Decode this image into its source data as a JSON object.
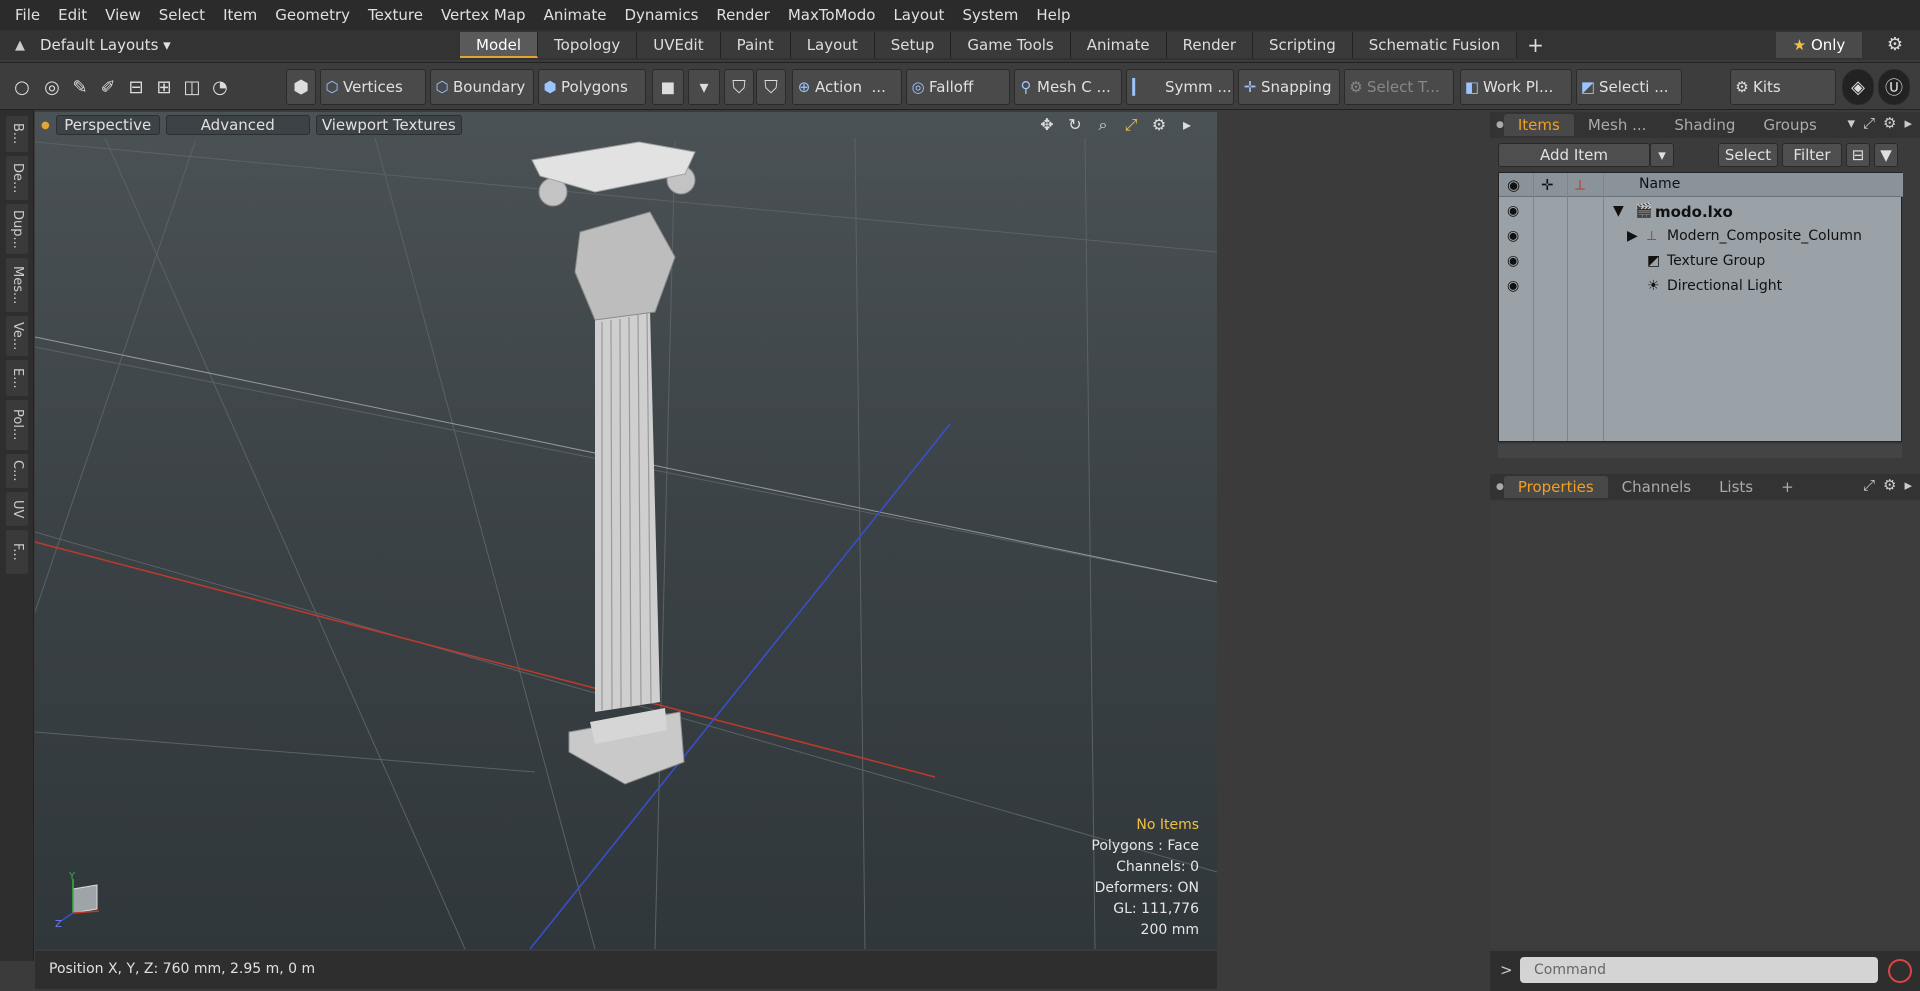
{
  "menu": [
    "File",
    "Edit",
    "View",
    "Select",
    "Item",
    "Geometry",
    "Texture",
    "Vertex Map",
    "Animate",
    "Dynamics",
    "Render",
    "MaxToModo",
    "Layout",
    "System",
    "Help"
  ],
  "layout": {
    "default_layouts": "Default Layouts",
    "tabs": [
      "Model",
      "Topology",
      "UVEdit",
      "Paint",
      "Layout",
      "Setup",
      "Game Tools",
      "Animate",
      "Render",
      "Scripting",
      "Schematic Fusion"
    ],
    "active_tab": "Model",
    "only_label": "Only"
  },
  "toolbar": {
    "vertices": "Vertices",
    "boundary": "Boundary",
    "polygons": "Polygons",
    "action": "Action",
    "action_more": "...",
    "falloff": "Falloff",
    "mesh_c": "Mesh C ...",
    "symm": "Symm ...",
    "snapping": "Snapping",
    "select_t": "Select T...",
    "work_pl": "Work Pl...",
    "selecti": "Selecti ...",
    "kits": "Kits"
  },
  "left_tabs": [
    "B...",
    "De...",
    "Dup...",
    "Mes...",
    "Ve...",
    "E...",
    "Pol...",
    "C...",
    "UV",
    "F..."
  ],
  "viewport": {
    "perspective": "Perspective",
    "advanced": "Advanced",
    "viewport_textures": "Viewport Textures",
    "hud": {
      "no_items": "No Items",
      "polygons": "Polygons : Face",
      "channels": "Channels: 0",
      "deformers": "Deformers: ON",
      "gl": "GL: 111,776",
      "scale": "200 mm"
    },
    "axis_labels": {
      "y": "Y",
      "z": "Z"
    }
  },
  "status": {
    "position": "Position X, Y, Z:  760 mm, 2.95 m, 0 m"
  },
  "items_panel": {
    "tabs": [
      "Items",
      "Mesh ...",
      "Shading",
      "Groups"
    ],
    "active_tab": "Items",
    "add_item": "Add Item",
    "select": "Select",
    "filter": "Filter",
    "column_name": "Name",
    "rows": [
      {
        "label": "modo.lxo"
      },
      {
        "label": "Modern_Composite_Column"
      },
      {
        "label": "Texture Group"
      },
      {
        "label": "Directional Light"
      }
    ]
  },
  "properties_panel": {
    "tabs": [
      "Properties",
      "Channels",
      "Lists"
    ],
    "active_tab": "Properties"
  },
  "command": {
    "placeholder": "Command"
  },
  "colors": {
    "accent_orange": "#e3a437",
    "hud_yellow": "#f0c040",
    "x_axis_red": "#c0392b",
    "z_axis_blue": "#3a4fd0"
  }
}
